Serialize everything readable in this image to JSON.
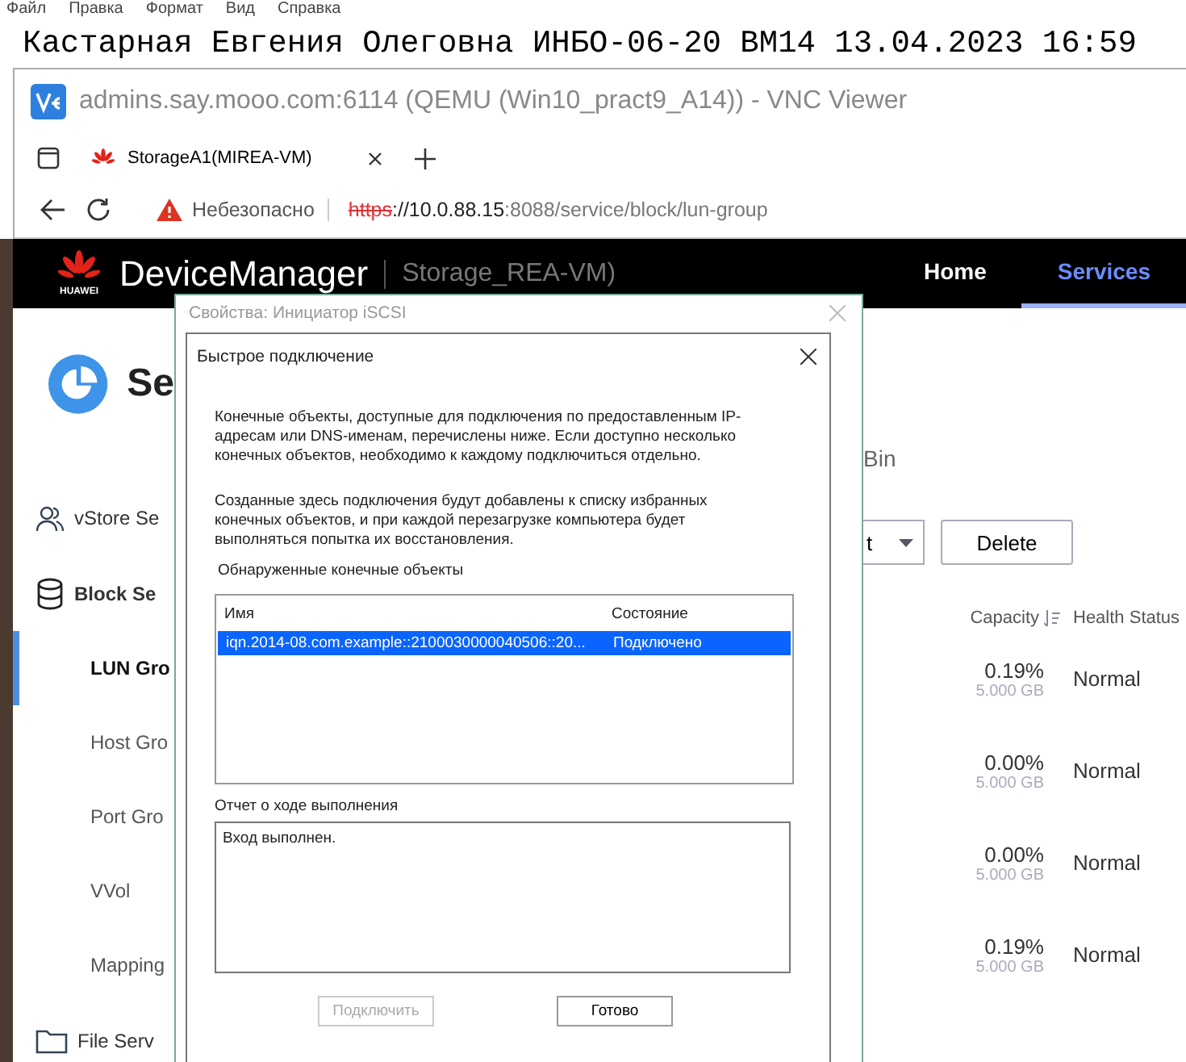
{
  "notepad": {
    "menu": [
      "Файл",
      "Правка",
      "Формат",
      "Вид",
      "Справка"
    ],
    "text": "Кастарная Евгения Олеговна ИНБО-06-20 ВМ14 13.04.2023 16:59"
  },
  "vnc_window": {
    "title": "admins.say.mooo.com:6114 (QEMU (Win10_pract9_A14)) - VNC Viewer"
  },
  "browser": {
    "tabs": [
      {
        "label": "StorageA1(MIREA-VM)"
      }
    ],
    "address": {
      "security": "Небезопасно",
      "scheme": "https",
      "host": "://10.0.88.15",
      "path": ":8088/service/block/lun-group"
    }
  },
  "app": {
    "brand": "HUAWEI",
    "product": "DeviceManager",
    "device": "Storage_REA-VM)",
    "nav": [
      {
        "label": "Home",
        "selected": false
      },
      {
        "label": "Services",
        "selected": true
      }
    ],
    "page_title": "Se",
    "sidebar": [
      {
        "label": "vStore Se",
        "kind": "users",
        "selected": false
      },
      {
        "label": "Block Se",
        "kind": "database",
        "selected": false,
        "children": [
          {
            "label": "LUN Gro",
            "selected": true
          },
          {
            "label": "Host Gro",
            "selected": false
          },
          {
            "label": "Port Gro",
            "selected": false
          },
          {
            "label": "VVol",
            "selected": false
          },
          {
            "label": "Mapping",
            "selected": false
          }
        ]
      },
      {
        "label": "File Serv",
        "kind": "folder",
        "selected": false
      }
    ],
    "tab_fragment": "Bin",
    "toolbar": [
      {
        "label": "t",
        "kind": "dropdown"
      },
      {
        "label": "Delete",
        "kind": "button"
      }
    ],
    "table": {
      "columns": [
        "Capacity",
        "Health Status"
      ],
      "rows": [
        {
          "usage": "0.19%",
          "capacity": "5.000 GB",
          "health": "Normal"
        },
        {
          "usage": "0.00%",
          "capacity": "5.000 GB",
          "health": "Normal"
        },
        {
          "usage": "0.00%",
          "capacity": "5.000 GB",
          "health": "Normal"
        },
        {
          "usage": "0.19%",
          "capacity": "5.000 GB",
          "health": "Normal"
        }
      ]
    }
  },
  "properties_dialog": {
    "title": "Свойства: Инициатор iSCSI",
    "close_disabled": true
  },
  "quick_connect_dialog": {
    "title": "Быстрое подключение",
    "paragraphs": [
      "Конечные объекты, доступные для подключения по предоставленным IP-адресам или DNS-именам, перечислены ниже.  Если доступно несколько конечных объектов, необходимо к каждому подключиться отдельно.",
      "Созданные здесь подключения будут добавлены к списку избранных конечных объектов, и при каждой перезагрузке компьютера будет выполняться попытка их восстановления."
    ],
    "targets_label": "Обнаруженные конечные объекты",
    "columns": [
      "Имя",
      "Состояние"
    ],
    "targets": [
      {
        "name": "iqn.2014-08.com.example::2100030000040506::20...",
        "status": "Подключено",
        "selected": true
      }
    ],
    "progress_label": "Отчет о ходе выполнения",
    "progress_text": "Вход выполнен.",
    "buttons": [
      {
        "label": "Подключить",
        "disabled": true
      },
      {
        "label": "Готово",
        "disabled": false
      }
    ]
  }
}
